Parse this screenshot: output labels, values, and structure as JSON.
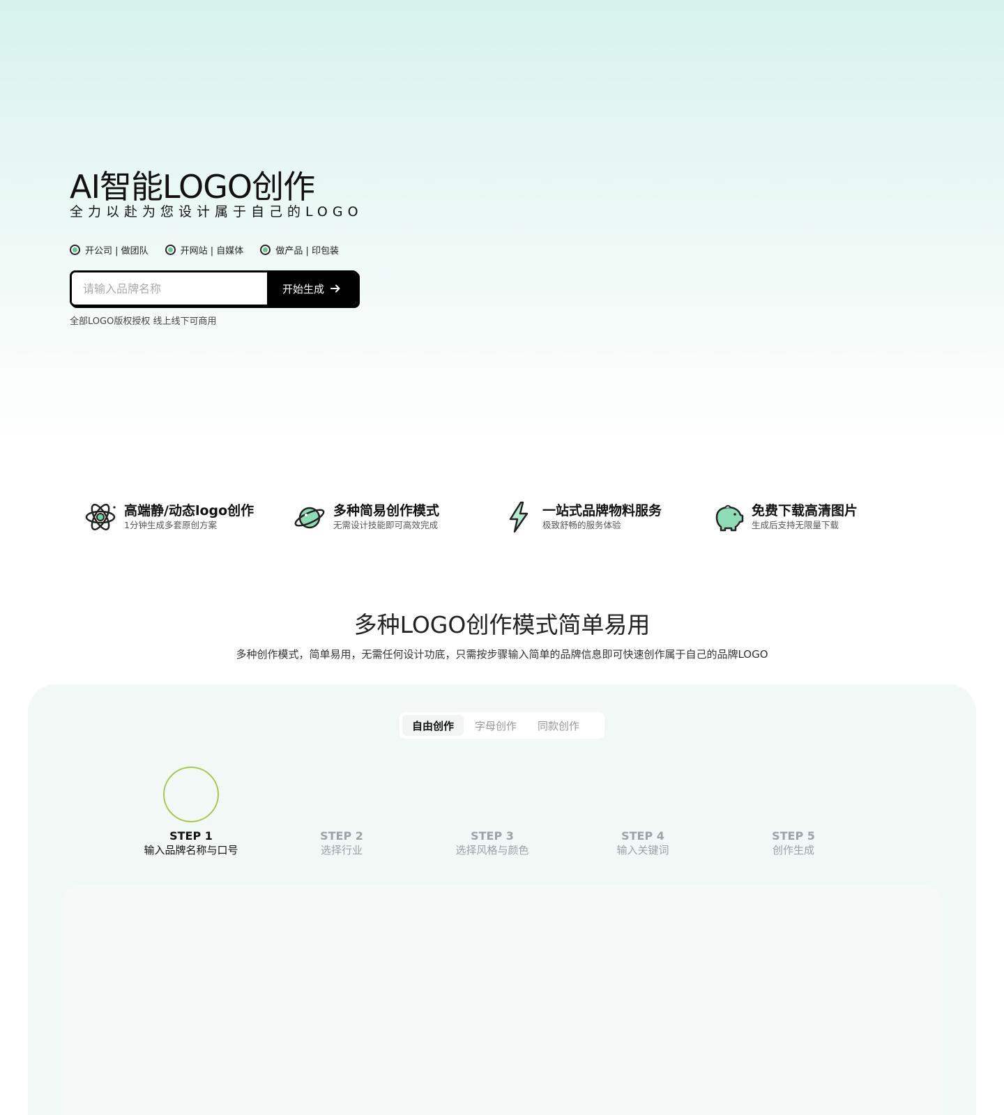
{
  "hero": {
    "title": "AI智能LOGO创作",
    "subtitle": "全力以赴为您设计属于自己的LOGO",
    "tags": [
      "开公司 | 做团队",
      "开网站 | 自媒体",
      "做产品 | 印包装"
    ],
    "search_placeholder": "请输入品牌名称",
    "start_label": "开始生成",
    "license_note": "全部LOGO版权授权 线上线下可商用"
  },
  "features": [
    {
      "icon": "atom-icon",
      "title": "高端静/动态logo创作",
      "desc": "1分钟生成多套原创方案"
    },
    {
      "icon": "planet-icon",
      "title": "多种简易创作模式",
      "desc": "无需设计技能即可高效完成"
    },
    {
      "icon": "lightning-icon",
      "title": "一站式品牌物料服务",
      "desc": "极致舒畅的服务体验"
    },
    {
      "icon": "piggy-bank-icon",
      "title": "免费下载高清图片",
      "desc": "生成后支持无限量下载"
    }
  ],
  "section": {
    "title": "多种LOGO创作模式简单易用",
    "desc": "多种创作模式，简单易用，无需任何设计功底，只需按步骤输入简单的品牌信息即可快速创作属于自己的品牌LOGO"
  },
  "tabs": [
    "自由创作",
    "字母创作",
    "同款创作"
  ],
  "active_tab": 0,
  "steps": [
    {
      "num": "STEP 1",
      "label": "输入品牌名称与口号"
    },
    {
      "num": "STEP 2",
      "label": "选择行业"
    },
    {
      "num": "STEP 3",
      "label": "选择风格与颜色"
    },
    {
      "num": "STEP 4",
      "label": "输入关键词"
    },
    {
      "num": "STEP 5",
      "label": "创作生成"
    }
  ],
  "active_step": 0,
  "colors": {
    "accent_green": "#5cc88f",
    "step_ring": "#a6c94a",
    "panel_bg": "#f1f8f6"
  }
}
